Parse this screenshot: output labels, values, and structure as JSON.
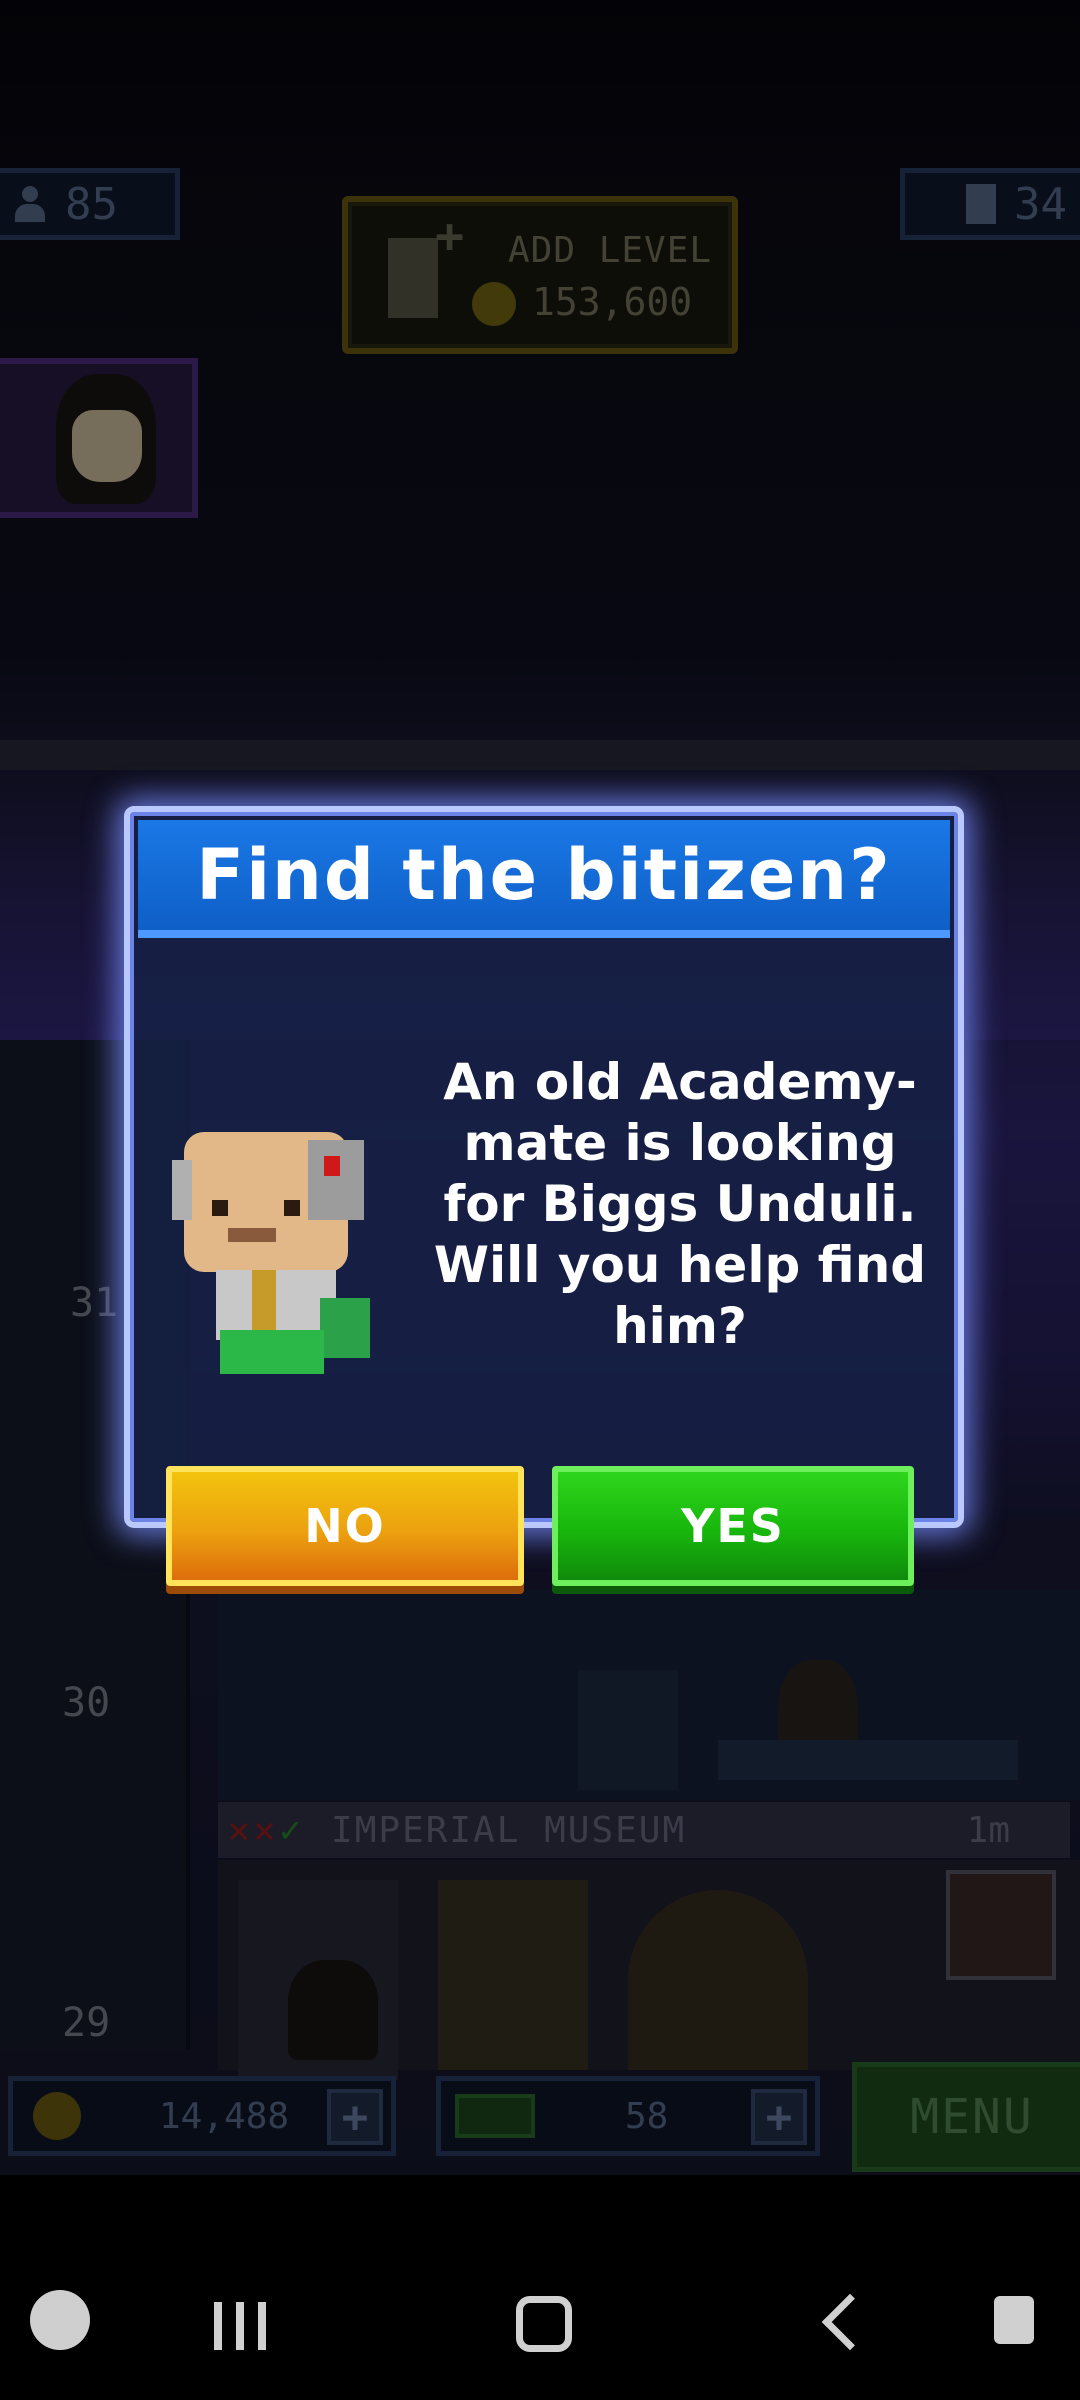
{
  "hud": {
    "population": "85",
    "floors": "34",
    "add_level_label": "ADD LEVEL",
    "add_level_cost": "153,600",
    "coins": "14,488",
    "bux": "58",
    "menu_label": "MENU"
  },
  "building": {
    "floor_30": "30",
    "floor_29": "29",
    "floor_31": "31",
    "museum_name": "IMPERIAL MUSEUM",
    "museum_depth": "1m"
  },
  "dialog": {
    "title": "Find the bitizen?",
    "message": "An old Academy-mate is looking for Biggs Unduli. Will you help find him?",
    "no_label": "NO",
    "yes_label": "YES"
  },
  "icons": {
    "population": "person-icon",
    "floors": "building-icon",
    "add_level": "add-document-icon",
    "coin": "coin-icon",
    "bux": "bux-icon",
    "plus": "plus-icon"
  },
  "colors": {
    "dialog_header": "#1670e0",
    "no_button": "#eca10f",
    "yes_button": "#18b60c"
  }
}
